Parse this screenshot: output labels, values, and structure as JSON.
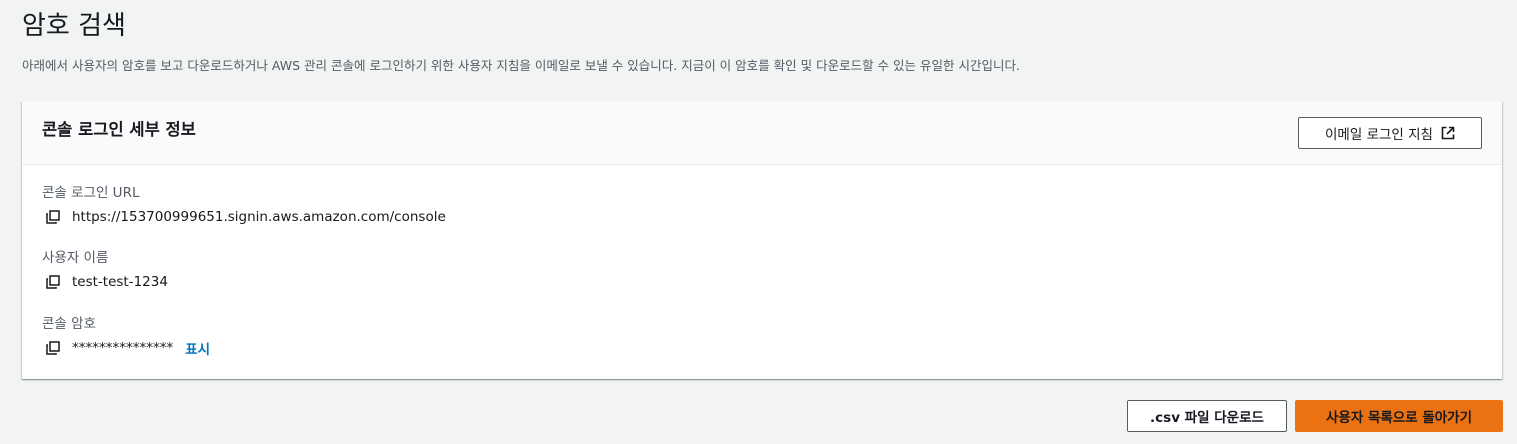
{
  "page": {
    "title": "암호 검색",
    "description": "아래에서 사용자의 암호를 보고 다운로드하거나 AWS 관리 콘솔에 로그인하기 위한 사용자 지침을 이메일로 보낼 수 있습니다. 지금이 이 암호를 확인 및 다운로드할 수 있는 유일한 시간입니다."
  },
  "panel": {
    "title": "콘솔 로그인 세부 정보",
    "email_button_label": "이메일 로그인 지침",
    "email_button_icon": "external-link-icon",
    "fields": [
      {
        "label": "콘솔 로그인 URL",
        "value": "https://153700999651.signin.aws.amazon.com/console",
        "icon": "copy-icon"
      },
      {
        "label": "사용자 이름",
        "value": "test-test-1234",
        "icon": "copy-icon"
      },
      {
        "label": "콘솔 암호",
        "value": "***************",
        "icon": "copy-icon",
        "show_label": "표시"
      }
    ]
  },
  "footer": {
    "csv_button_label": ".csv 파일 다운로드",
    "back_button_label": "사용자 목록으로 돌아가기"
  },
  "colors": {
    "page_background": "#f2f3f3",
    "primary_button": "#ec7211",
    "link": "#0073bb",
    "text": "#16191f",
    "secondary_text": "#545b64"
  }
}
